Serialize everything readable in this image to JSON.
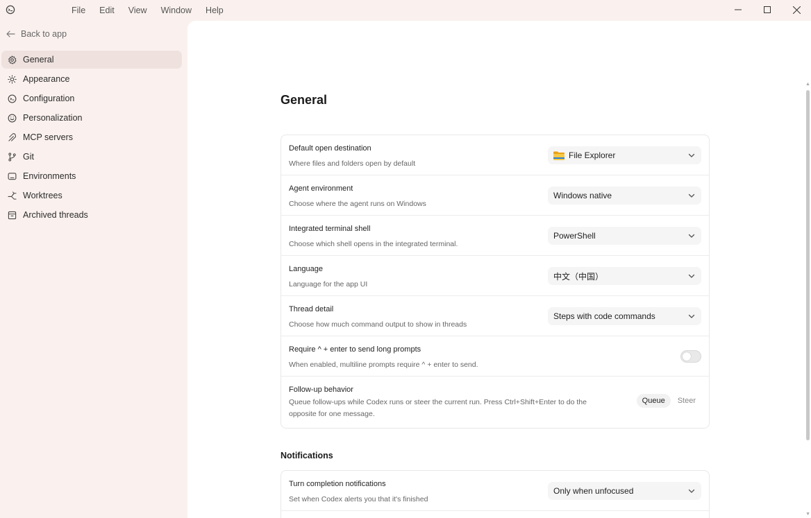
{
  "menu": [
    "File",
    "Edit",
    "View",
    "Window",
    "Help"
  ],
  "sidebar": {
    "back_label": "Back to app",
    "items": [
      {
        "label": "General",
        "icon": "gear-icon",
        "active": true
      },
      {
        "label": "Appearance",
        "icon": "sun-icon"
      },
      {
        "label": "Configuration",
        "icon": "settings-circle-icon"
      },
      {
        "label": "Personalization",
        "icon": "smile-icon"
      },
      {
        "label": "MCP servers",
        "icon": "plug-icon"
      },
      {
        "label": "Git",
        "icon": "git-branch-icon"
      },
      {
        "label": "Environments",
        "icon": "monitor-icon"
      },
      {
        "label": "Worktrees",
        "icon": "worktree-icon"
      },
      {
        "label": "Archived threads",
        "icon": "archive-icon"
      }
    ]
  },
  "main": {
    "title": "General",
    "rows": [
      {
        "title": "Default open destination",
        "desc": "Where files and folders open by default",
        "value": "File Explorer"
      },
      {
        "title": "Agent environment",
        "desc": "Choose where the agent runs on Windows",
        "value": "Windows native"
      },
      {
        "title": "Integrated terminal shell",
        "desc": "Choose which shell opens in the integrated terminal.",
        "value": "PowerShell"
      },
      {
        "title": "Language",
        "desc": "Language for the app UI",
        "value": "中文（中国）"
      },
      {
        "title": "Thread detail",
        "desc": "Choose how much command output to show in threads",
        "value": "Steps with code commands"
      },
      {
        "title": "Require ^ + enter to send long prompts",
        "desc": "When enabled, multiline prompts require ^ + enter to send.",
        "toggle": false
      },
      {
        "title": "Follow-up behavior",
        "desc": "Queue follow-ups while Codex runs or steer the current run. Press Ctrl+Shift+Enter to do the opposite for one message.",
        "options": [
          "Queue",
          "Steer"
        ],
        "selected": "Queue"
      }
    ],
    "notifications": {
      "title": "Notifications",
      "rows": [
        {
          "title": "Turn completion notifications",
          "desc": "Set when Codex alerts you that it's finished",
          "value": "Only when unfocused"
        }
      ]
    }
  }
}
